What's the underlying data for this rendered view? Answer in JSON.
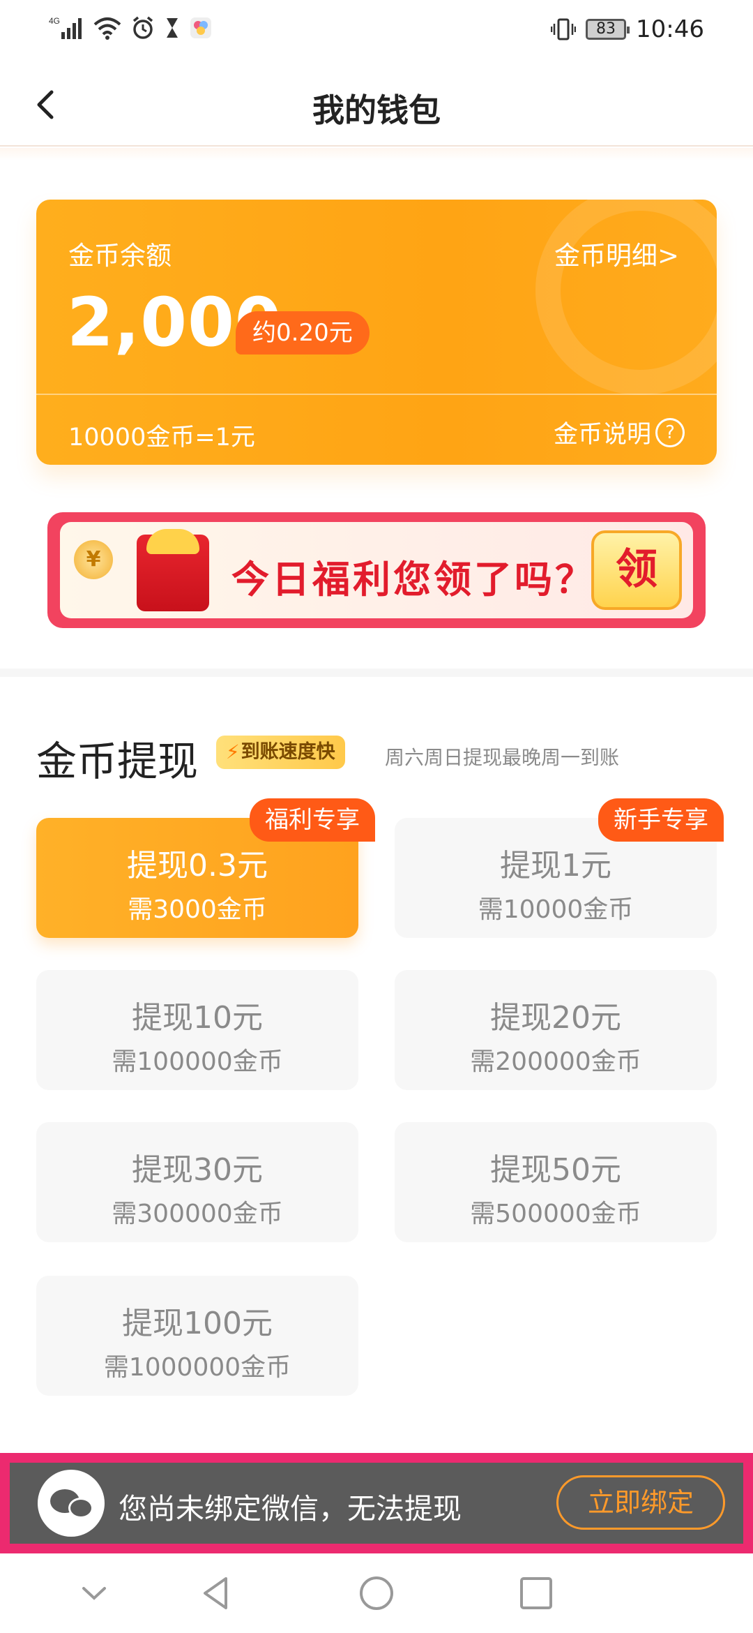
{
  "status_bar": {
    "network": "4G",
    "battery": "83",
    "time": "10:46"
  },
  "header": {
    "title": "我的钱包"
  },
  "coin_card": {
    "label": "金币余额",
    "detail_link": "金币明细>",
    "balance": "2,000",
    "approx_value": "约0.20元",
    "rate": "10000金币=1元",
    "explain_link": "金币说明",
    "help_icon_text": "?"
  },
  "banner": {
    "coin_symbol": "¥",
    "text": "今日福利您领了吗？",
    "claim": "领"
  },
  "withdraw": {
    "title": "金币提现",
    "speed_badge": "到账速度快",
    "note": "周六周日提现最晚周一到账",
    "options": [
      {
        "amount": "提现0.3元",
        "cost": "需3000金币",
        "tag": "福利专享",
        "selected": true
      },
      {
        "amount": "提现1元",
        "cost": "需10000金币",
        "tag": "新手专享",
        "selected": false
      },
      {
        "amount": "提现10元",
        "cost": "需100000金币"
      },
      {
        "amount": "提现20元",
        "cost": "需200000金币"
      },
      {
        "amount": "提现30元",
        "cost": "需300000金币"
      },
      {
        "amount": "提现50元",
        "cost": "需500000金币"
      },
      {
        "amount": "提现100元",
        "cost": "需1000000金币"
      }
    ]
  },
  "bind_bar": {
    "message": "您尚未绑定微信，无法提现",
    "button": "立即绑定"
  },
  "colors": {
    "accent": "#ffa414",
    "tag": "#ff5a16",
    "banner_border": "#f2435f",
    "highlight": "#ec2a6f"
  },
  "icons": [
    "back-icon",
    "signal-icon",
    "wifi-icon",
    "alarm-icon",
    "hourglass-icon",
    "vibrate-icon",
    "help-icon",
    "bolt-icon",
    "wechat-icon",
    "nav-down-icon",
    "nav-back-icon",
    "nav-home-icon",
    "nav-recents-icon"
  ]
}
